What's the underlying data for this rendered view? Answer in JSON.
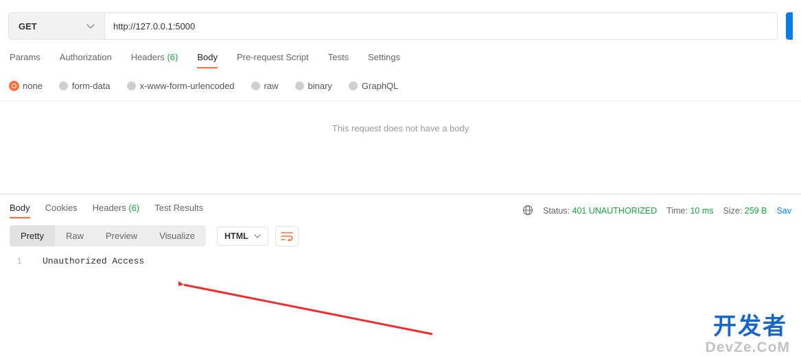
{
  "request": {
    "method": "GET",
    "url": "http://127.0.0.1:5000"
  },
  "request_tabs": {
    "items": [
      "Params",
      "Authorization",
      "Headers",
      "Body",
      "Pre-request Script",
      "Tests",
      "Settings"
    ],
    "headers_count": "(6)",
    "active": "Body"
  },
  "body_types": {
    "items": [
      "none",
      "form-data",
      "x-www-form-urlencoded",
      "raw",
      "binary",
      "GraphQL"
    ],
    "selected": "none"
  },
  "body_empty_msg": "This request does not have a body",
  "response_tabs": {
    "items": [
      "Body",
      "Cookies",
      "Headers",
      "Test Results"
    ],
    "headers_count": "(6)",
    "active": "Body"
  },
  "response_meta": {
    "status_label": "Status:",
    "status_value": "401 UNAUTHORIZED",
    "time_label": "Time:",
    "time_value": "10 ms",
    "size_label": "Size:",
    "size_value": "259 B",
    "save_label": "Sav"
  },
  "response_view": {
    "tabs": [
      "Pretty",
      "Raw",
      "Preview",
      "Visualize"
    ],
    "active": "Pretty",
    "lang": "HTML"
  },
  "response_body": {
    "line_no": "1",
    "text": "Unauthorized Access"
  },
  "watermark": {
    "cn": "开发者",
    "en": "DevZe.CoM"
  }
}
